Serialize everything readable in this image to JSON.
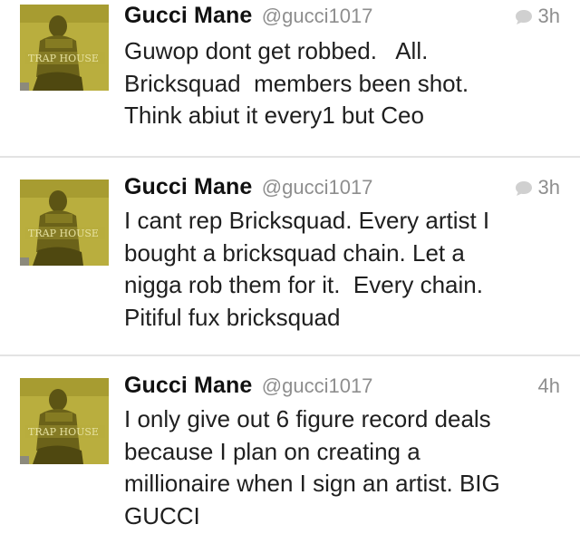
{
  "tweets": [
    {
      "author_name": "Gucci Mane",
      "handle": "@gucci1017",
      "time": "3h",
      "has_reply_icon": true,
      "avatar_text": "TRAP HOUSE",
      "lines": [
        "Guwop dont get robbed.   All.",
        "Bricksquad  members been shot.",
        "Think abiut it every1 but Ceo"
      ]
    },
    {
      "author_name": "Gucci Mane",
      "handle": "@gucci1017",
      "time": "3h",
      "has_reply_icon": true,
      "avatar_text": "TRAP HOUSE",
      "lines": [
        "I cant rep Bricksquad. Every artist I",
        "bought a bricksquad chain. Let a",
        "nigga rob them for it.  Every chain.",
        "Pitiful fux bricksquad"
      ]
    },
    {
      "author_name": "Gucci Mane",
      "handle": "@gucci1017",
      "time": "4h",
      "has_reply_icon": false,
      "avatar_text": "TRAP HOUSE",
      "lines": [
        "I only give out 6 figure record deals",
        "because I plan on creating a",
        "millionaire when I sign an artist. BIG",
        "GUCCI"
      ]
    }
  ],
  "colors": {
    "avatar_bg": "#b7ad3c",
    "avatar_text": "#e6e1a0",
    "meta_gray": "#8e8e8e",
    "divider": "#e3e3e3"
  }
}
